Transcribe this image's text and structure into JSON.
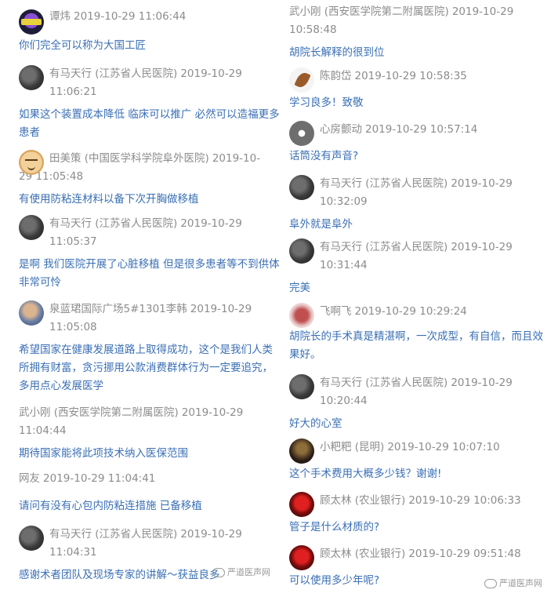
{
  "left": [
    {
      "name": "谭炜",
      "time": "2019-10-29 11:06:44",
      "message": "你们完全可以称为大国工匠",
      "avatar": "purple-logo"
    },
    {
      "name": "有马天行 (江苏省人民医院)",
      "time": "2019-10-29",
      "time2": "11:06:21",
      "message": "如果这个装置成本降低 临床可以推广 必然可以造福更多患者",
      "avatar": "horse"
    },
    {
      "name": "田美策 (中国医学科学院阜外医院)",
      "time": "2019-10-",
      "time2": "29 11:05:48",
      "message": "有使用防粘连材料以备下次开胸做移植",
      "avatar": "face"
    },
    {
      "name": "有马天行 (江苏省人民医院)",
      "time": "2019-10-29",
      "time2": "11:05:37",
      "message": "是啊 我们医院开展了心脏移植 但是很多患者等不到供体 非常可怜",
      "avatar": "horse"
    },
    {
      "name": "泉蓝珺国际广场5#1301李韩",
      "time": "2019-10-29",
      "time2": "11:05:08",
      "message": "希望国家在健康发展道路上取得成功，这个是我们人类所拥有财富，贪污挪用公款消费群体行为一定要追究，多用点心发展医学",
      "avatar": "child"
    },
    {
      "name": "武小刚 (西安医学院第二附属医院)",
      "time": "2019-10-29",
      "time2": "11:04:44",
      "message": "期待国家能将此项技术纳入医保范围",
      "avatar": ""
    },
    {
      "name": "网友",
      "time": "2019-10-29 11:04:41",
      "message": "请问有没有心包内防粘连措施 已备移植",
      "avatar": ""
    },
    {
      "name": "有马天行 (江苏省人民医院)",
      "time": "2019-10-29",
      "time2": "11:04:31",
      "message": "感谢术者团队及现场专家的讲解～获益良多",
      "avatar": "horse"
    }
  ],
  "right": [
    {
      "name": "武小刚 (西安医学院第二附属医院)",
      "time": "2019-10-29",
      "time2": "10:58:48",
      "message": "胡院长解释的很到位",
      "avatar": ""
    },
    {
      "name": "陈韵岱",
      "time": "2019-10-29 10:58:35",
      "message": "学习良多！致敬",
      "avatar": "leaf"
    },
    {
      "name": "心房颤动",
      "time": "2019-10-29 10:57:14",
      "message": "话筒没有声音?",
      "avatar": "flower"
    },
    {
      "name": "有马天行 (江苏省人民医院)",
      "time": "2019-10-29",
      "time2": "10:32:09",
      "message": "阜外就是阜外",
      "avatar": "horse"
    },
    {
      "name": "有马天行 (江苏省人民医院)",
      "time": "2019-10-29",
      "time2": "10:31:44",
      "message": "完美",
      "avatar": "horse"
    },
    {
      "name": "飞啊飞",
      "time": "2019-10-29 10:29:24",
      "message": "胡院长的手术真是精湛啊，一次成型，有自信，而且效果好。",
      "avatar": "red"
    },
    {
      "name": "有马天行 (江苏省人民医院)",
      "time": "2019-10-29",
      "time2": "10:20:44",
      "message": "好大的心室",
      "avatar": "horse"
    },
    {
      "name": "小粑粑 (昆明)",
      "time": "2019-10-29 10:07:10",
      "message": "这个手术费用大概多少钱？谢谢!",
      "avatar": "dark"
    },
    {
      "name": "顾太林 (农业银行)",
      "time": "2019-10-29 10:06:33",
      "message": "管子是什么材质的?",
      "avatar": "rose"
    },
    {
      "name": "顾太林 (农业银行)",
      "time": "2019-10-29 09:51:48",
      "message": "可以使用多少年呢?",
      "avatar": "rose"
    }
  ],
  "watermark": "严道医声网"
}
